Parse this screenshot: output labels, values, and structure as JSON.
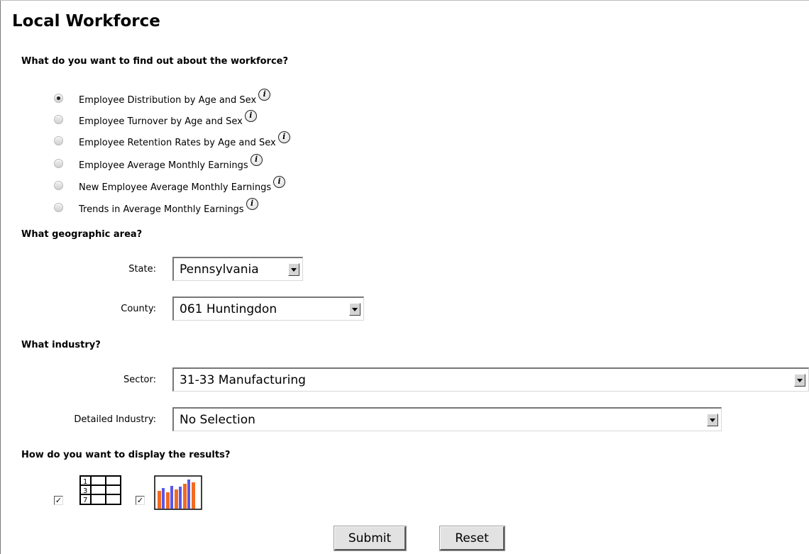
{
  "page": {
    "title": "Local Workforce"
  },
  "workforce": {
    "question": "What do you want to find out about the workforce?",
    "options": [
      {
        "label": "Employee Distribution by Age and Sex",
        "selected": true
      },
      {
        "label": "Employee Turnover by Age and Sex",
        "selected": false
      },
      {
        "label": "Employee Retention Rates by Age and Sex",
        "selected": false
      },
      {
        "label": "Employee Average Monthly Earnings",
        "selected": false
      },
      {
        "label": "New Employee Average Monthly Earnings",
        "selected": false
      },
      {
        "label": "Trends in Average Monthly Earnings",
        "selected": false
      }
    ],
    "info_glyph": "i"
  },
  "geography": {
    "question": "What geographic area?",
    "state_label": "State:",
    "state_value": "Pennsylvania",
    "county_label": "County:",
    "county_value": "061 Huntingdon"
  },
  "industry": {
    "question": "What industry?",
    "sector_label": "Sector:",
    "sector_value": "31-33 Manufacturing",
    "detailed_label": "Detailed Industry:",
    "detailed_value": "No Selection"
  },
  "display": {
    "question": "How do you want to display the results?",
    "table_checked": true,
    "chart_checked": true,
    "check_glyph": "✓",
    "table_icon_numbers": [
      "1",
      "3",
      "7"
    ],
    "chart_icon_colors": {
      "orange": "#f26a21",
      "blue": "#5b57e8"
    }
  },
  "actions": {
    "submit_label": "Submit",
    "reset_label": "Reset"
  }
}
